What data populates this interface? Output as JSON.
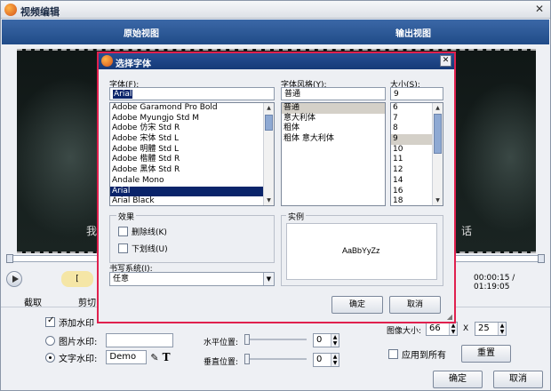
{
  "window": {
    "title": "视频编辑",
    "close": "✕"
  },
  "tabs": {
    "left": "原始视图",
    "right": "输出视图"
  },
  "preview": {
    "subtitle_left": "我",
    "subtitle_right": "话"
  },
  "player": {
    "marker": "[",
    "time": "00:00:15 / 01:19:05"
  },
  "ops": {
    "crop": "截取",
    "cut": "剪切"
  },
  "watermark": {
    "add_label": "添加水印",
    "image_label": "图片水印:",
    "text_label": "文字水印:",
    "text_value": "Demo",
    "text_icon": "T"
  },
  "position": {
    "h_label": "水平位置:",
    "v_label": "垂直位置:",
    "h_value": "0",
    "v_value": "0"
  },
  "image_size": {
    "label": "图像大小:",
    "w": "66",
    "x": "X",
    "h": "25"
  },
  "apply_all": "应用到所有",
  "reset": "重置",
  "ok": "确定",
  "cancel": "取消",
  "font_dialog": {
    "title": "选择字体",
    "font_label": "字体(F):",
    "font_value": "Arial",
    "fonts": [
      "Adobe Garamond Pro Bold",
      "Adobe Myungjo Std M",
      "Adobe 仿宋 Std R",
      "Adobe 宋体 Std L",
      "Adobe 明體 Std L",
      "Adobe 楷體 Std R",
      "Adobe 黑体 Std R",
      "Andale Mono",
      "Arial",
      "Arial Black"
    ],
    "selected_font": "Arial",
    "style_label": "字体风格(Y):",
    "style_value": "普通",
    "styles": [
      "普通",
      "意大利体",
      "粗体",
      "粗体 意大利体"
    ],
    "size_label": "大小(S):",
    "size_value": "9",
    "sizes": [
      "6",
      "7",
      "8",
      "9",
      "10",
      "11",
      "12",
      "14",
      "16",
      "18"
    ],
    "effects_label": "效果",
    "strike_label": "删除线(K)",
    "underline_label": "下划线(U)",
    "sample_label": "实例",
    "sample_text": "AaBbYyZz",
    "script_label": "书写系统(I):",
    "script_value": "任意",
    "ok": "确定",
    "cancel": "取消"
  },
  "colors": {
    "accent": "#e0204e",
    "tab_bar": "#204b88",
    "selection": "#0a246a"
  }
}
